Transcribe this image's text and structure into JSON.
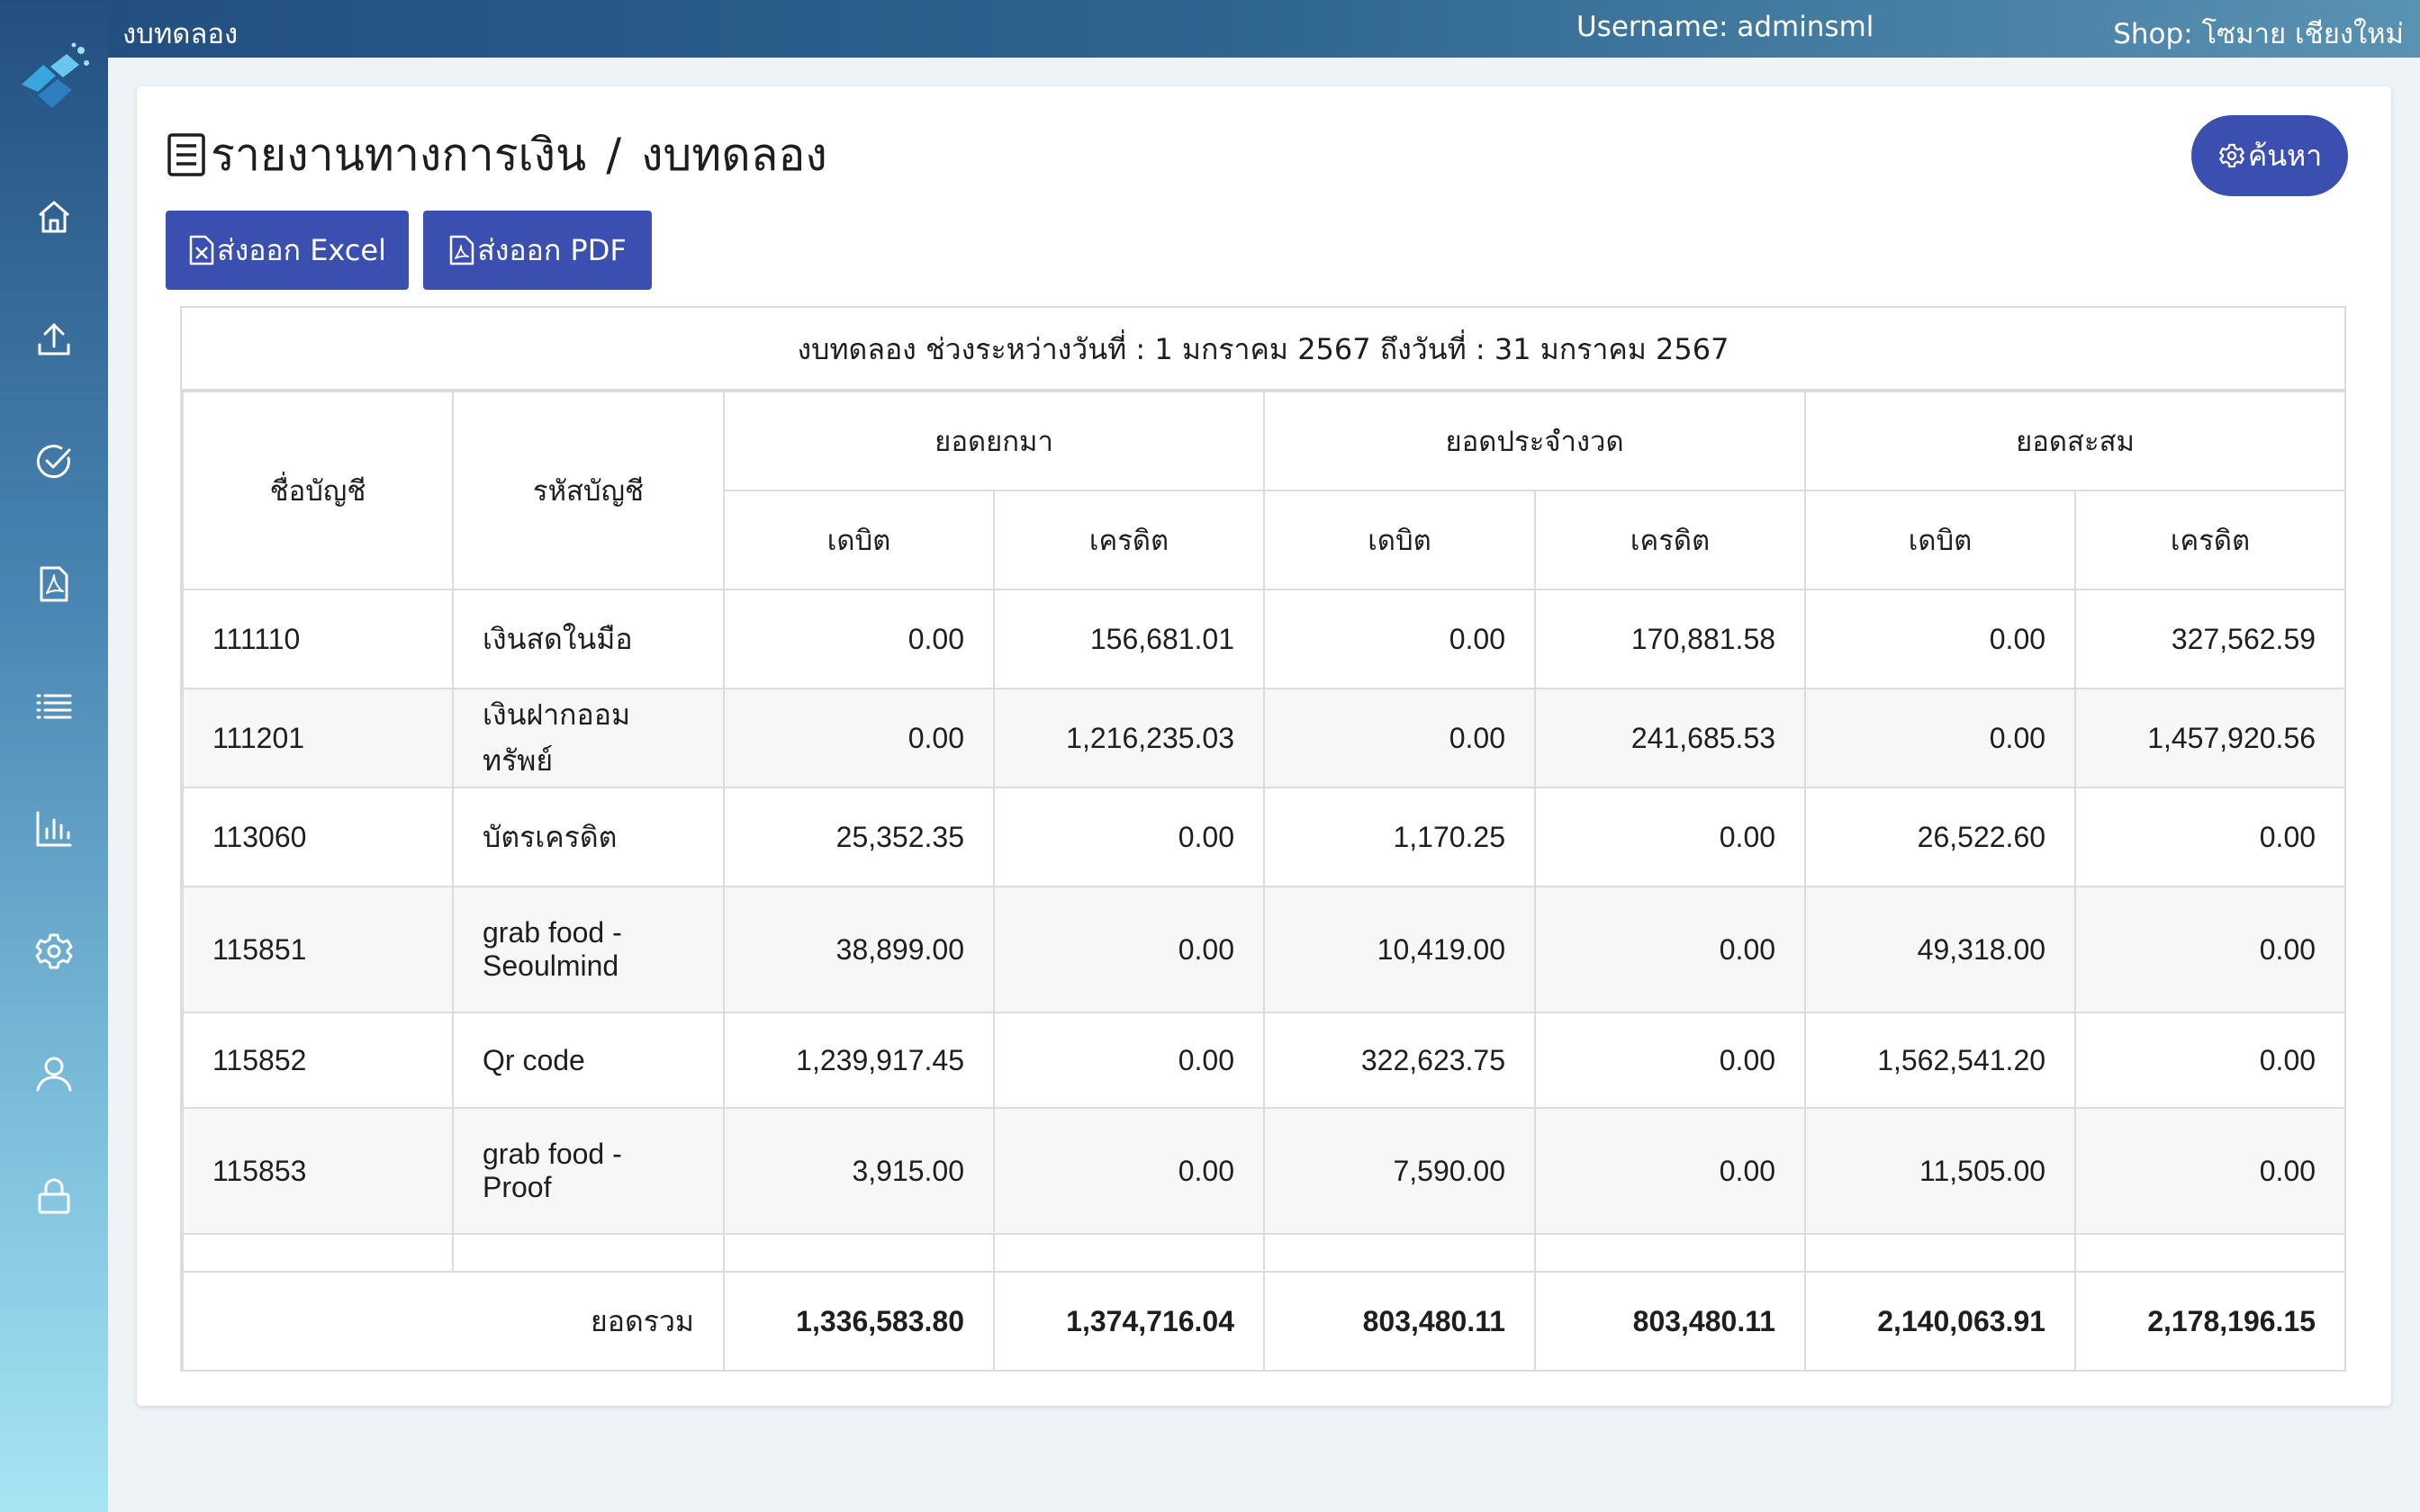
{
  "topbar": {
    "page_name": "งบทดลอง",
    "username": "Username: adminsml",
    "shop": "Shop: โซมาย เชียงใหม่"
  },
  "sidebar": {
    "items": [
      {
        "icon": "home-icon"
      },
      {
        "icon": "upload-icon"
      },
      {
        "icon": "check-circle-icon"
      },
      {
        "icon": "pdf-file-icon"
      },
      {
        "icon": "list-icon"
      },
      {
        "icon": "bar-chart-icon"
      },
      {
        "icon": "gear-icon"
      },
      {
        "icon": "user-icon"
      },
      {
        "icon": "lock-icon"
      }
    ]
  },
  "breadcrumb": {
    "parent": "รายงานทางการเงิน",
    "separator": "/",
    "current": "งบทดลอง"
  },
  "actions": {
    "search_label": "ค้นหา",
    "export_excel_label": "ส่งออก Excel",
    "export_pdf_label": "ส่งออก PDF"
  },
  "report": {
    "caption": "งบทดลอง ช่วงระหว่างวันที่ : 1 มกราคม 2567 ถึงวันที่ : 31 มกราคม 2567",
    "headers": {
      "account_name": "ชื่อบัญชี",
      "account_code": "รหัสบัญชี",
      "brought_forward": "ยอดยกมา",
      "period": "ยอดประจำงวด",
      "accumulated": "ยอดสะสม",
      "debit": "เดบิต",
      "credit": "เครดิต"
    },
    "rows": [
      {
        "col1": "111110",
        "col2": "เงินสดในมือ",
        "values": [
          "0.00",
          "156,681.01",
          "0.00",
          "170,881.58",
          "0.00",
          "327,562.59"
        ]
      },
      {
        "col1": "111201",
        "col2": "เงินฝากออมทรัพย์",
        "values": [
          "0.00",
          "1,216,235.03",
          "0.00",
          "241,685.53",
          "0.00",
          "1,457,920.56"
        ]
      },
      {
        "col1": "113060",
        "col2": "บัตรเครดิต",
        "values": [
          "25,352.35",
          "0.00",
          "1,170.25",
          "0.00",
          "26,522.60",
          "0.00"
        ]
      },
      {
        "col1": "115851",
        "col2": "grab food - Seoulmind",
        "values": [
          "38,899.00",
          "0.00",
          "10,419.00",
          "0.00",
          "49,318.00",
          "0.00"
        ]
      },
      {
        "col1": "115852",
        "col2": "Qr code",
        "values": [
          "1,239,917.45",
          "0.00",
          "322,623.75",
          "0.00",
          "1,562,541.20",
          "0.00"
        ]
      },
      {
        "col1": "115853",
        "col2": "grab food - Proof",
        "values": [
          "3,915.00",
          "0.00",
          "7,590.00",
          "0.00",
          "11,505.00",
          "0.00"
        ]
      }
    ],
    "total_label": "ยอดรวม",
    "totals": [
      "1,336,583.80",
      "1,374,716.04",
      "803,480.11",
      "803,480.11",
      "2,140,063.91",
      "2,178,196.15"
    ]
  }
}
